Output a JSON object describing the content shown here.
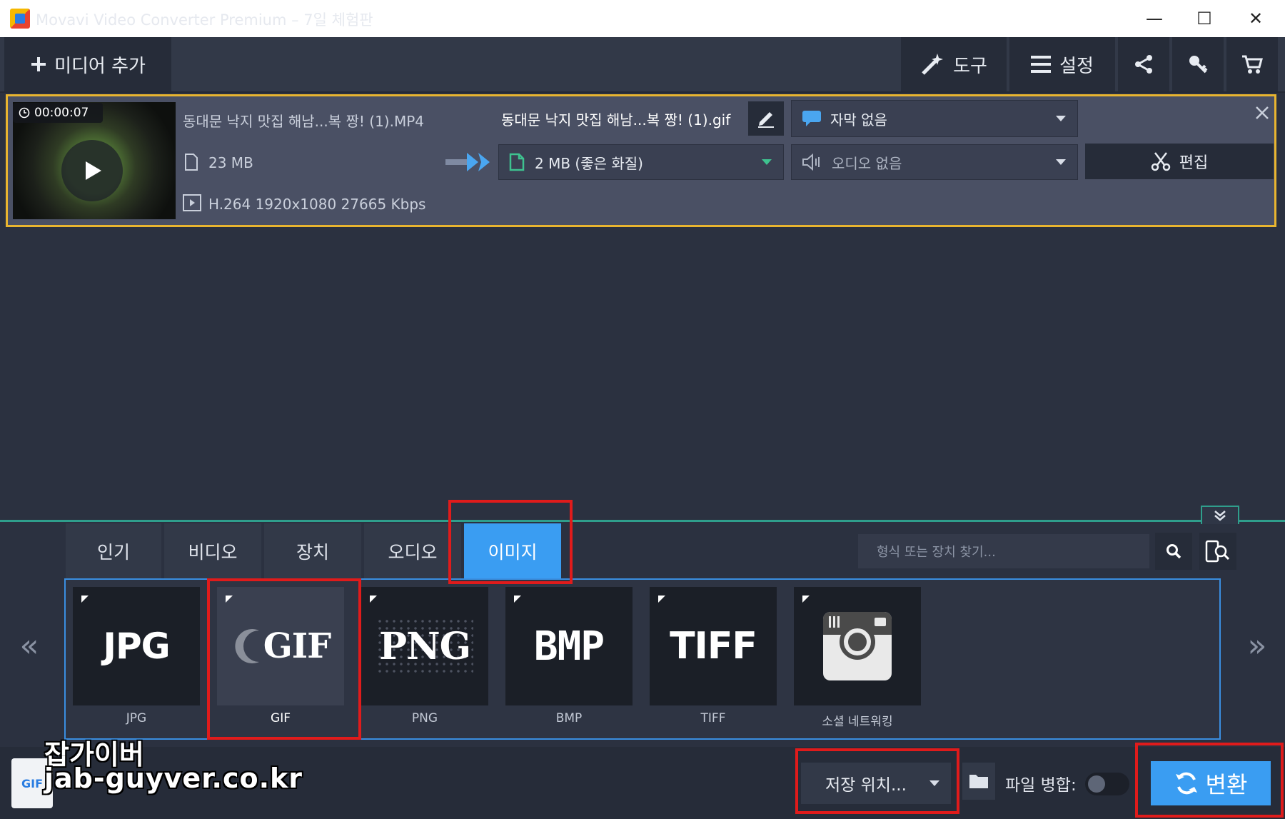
{
  "window": {
    "title": "Movavi Video Converter Premium – 7일 체험판",
    "minimize": "—",
    "maximize": "☐",
    "close": "✕"
  },
  "toolbar": {
    "add_media": "미디어 추가",
    "tools": "도구",
    "settings": "설정"
  },
  "file": {
    "duration": "00:00:07",
    "source_name": "동대문 낙지 맛집 해남...복 짱! (1).MP4",
    "source_size": "23 MB",
    "source_codec": "H.264 1920x1080 27665 Kbps",
    "output_name": "동대문 낙지 맛집 해남...복 짱! (1).gif",
    "output_size": "2 MB (좋은 화질)",
    "subtitles": "자막 없음",
    "audio": "오디오 없음",
    "edit": "편집"
  },
  "format_tabs": [
    {
      "label": "인기"
    },
    {
      "label": "비디오"
    },
    {
      "label": "장치"
    },
    {
      "label": "오디오"
    },
    {
      "label": "이미지",
      "active": true
    }
  ],
  "search": {
    "placeholder": "형식 또는 장치 찾기..."
  },
  "formats": [
    {
      "label": "JPG",
      "logo": "JPG"
    },
    {
      "label": "GIF",
      "logo": "GIF",
      "selected": true
    },
    {
      "label": "PNG",
      "logo": "PNG"
    },
    {
      "label": "BMP",
      "logo": "BMP"
    },
    {
      "label": "TIFF",
      "logo": "TIFF"
    },
    {
      "label": "소셜 네트워킹",
      "logo": "camera-icon"
    }
  ],
  "bottom": {
    "output_badge": "GIF",
    "save_location": "저장 위치...",
    "merge_files": "파일 병합:",
    "merge_enabled": false,
    "convert": "변환"
  },
  "watermark": {
    "line1": "잡가이버",
    "line2": "jab-guyver.co.kr"
  },
  "colors": {
    "accent": "#3a9df2",
    "highlight_border": "#e9b530",
    "annotation_red": "#e01b1b"
  }
}
